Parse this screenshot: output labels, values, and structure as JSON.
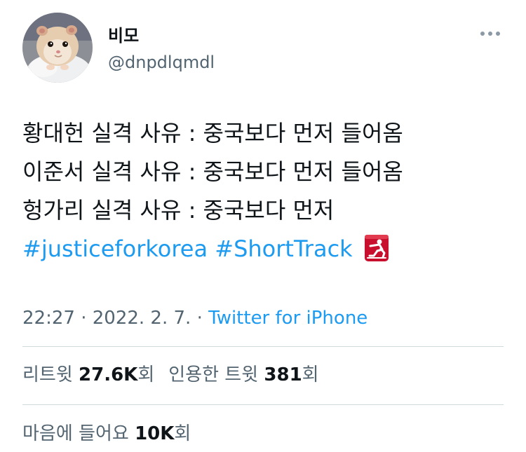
{
  "user": {
    "display_name": "비모",
    "handle": "@dnpdlqmdl",
    "avatar": "hamster-avatar"
  },
  "tweet": {
    "lines": [
      "황대헌 실격 사유 : 중국보다 먼저 들어옴",
      "이준서 실격 사유 : 중국보다 먼저 들어옴",
      "헝가리 실격 사유 : 중국보다 먼저"
    ],
    "hashtags": [
      "#justiceforkorea",
      "#ShortTrack"
    ],
    "emoji": "speed-skater-icon"
  },
  "meta": {
    "time": "22:27",
    "separator": " · ",
    "date": "2022. 2. 7.",
    "source": "Twitter for iPhone"
  },
  "stats": {
    "retweets_label": "리트윗",
    "retweets_count": "27.6K",
    "retweets_unit": "회",
    "quotes_label": "인용한 트윗",
    "quotes_count": "381",
    "quotes_unit": "회",
    "likes_label": "마음에 들어요",
    "likes_count": "10K",
    "likes_unit": "회"
  },
  "colors": {
    "link": "#1d9bf0",
    "secondary_text": "#536471",
    "primary_text": "#0f1419",
    "divider": "#cfd9de",
    "emoji_red": "#c8102e"
  }
}
